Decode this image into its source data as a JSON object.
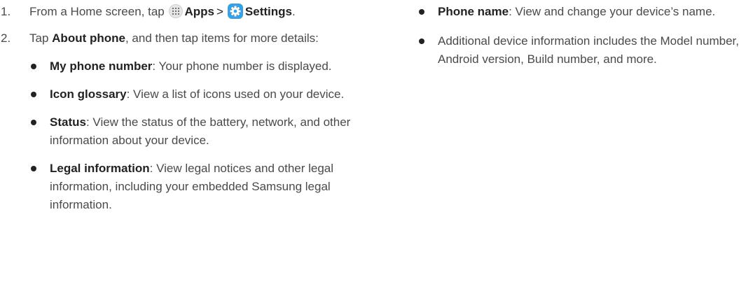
{
  "left_column": {
    "step1": {
      "number": "1.",
      "prefix": "From a Home screen, tap",
      "apps_label": "Apps",
      "separator": ">",
      "settings_label": "Settings",
      "suffix": "."
    },
    "step2": {
      "number": "2.",
      "prefix": "Tap",
      "about_label": "About phone",
      "suffix": ", and then tap items for more details:"
    },
    "bullets": [
      {
        "term": "My phone number",
        "text": ": Your phone number is displayed."
      },
      {
        "term": "Icon glossary",
        "text": ": View a list of icons used on your device."
      },
      {
        "term": "Status",
        "text": ": View the status of the battery, network, and other information about your device."
      },
      {
        "term": "Legal information",
        "text": ": View legal notices and other legal information, including your embedded Samsung legal information."
      }
    ]
  },
  "right_column": {
    "bullets": [
      {
        "term": "Phone name",
        "text": ": View and change your device’s name."
      },
      {
        "term": "",
        "text": "Additional device information includes the Model number, Android version, Build number, and more."
      }
    ]
  },
  "icons": {
    "apps": "apps-grid-icon",
    "settings": "settings-gear-icon",
    "bullet": "bullet-dot-icon"
  },
  "colors": {
    "body_text": "#4a4a4a",
    "emphasis_text": "#222222",
    "settings_icon_bg": "#3aa0de"
  }
}
